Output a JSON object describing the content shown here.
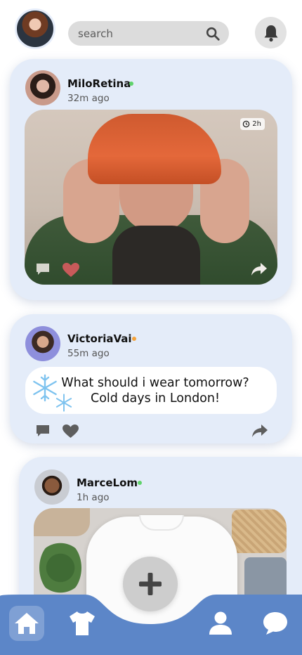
{
  "header": {
    "search": {
      "placeholder": "search"
    },
    "icons": [
      "profile-avatar",
      "search-icon",
      "bell-icon"
    ]
  },
  "posts": [
    {
      "username": "MiloRetina",
      "time": "32m ago",
      "status_color": "#5fd36b",
      "photo_badge": "2h",
      "icons": [
        "comment-icon",
        "heart-icon",
        "share-icon"
      ]
    },
    {
      "username": "VictoriaVai",
      "time": "55m ago",
      "status_color": "#f5a33b",
      "text_line1": "What should i wear tomorrow?",
      "text_line2": "Cold days in London!",
      "icons": [
        "snowflake-icon",
        "comment-icon",
        "heart-icon",
        "share-icon"
      ]
    },
    {
      "username": "MarceLom",
      "time": "1h ago",
      "status_color": "#5fd36b"
    }
  ],
  "colors": {
    "card_background": "#e4ecf9",
    "nav_background": "#5c86c8",
    "like_active": "#c85a5a"
  },
  "bottom_nav": {
    "items": [
      "home-icon",
      "tshirt-icon",
      "add-icon",
      "profile-icon",
      "chat-icon"
    ],
    "active": "home"
  }
}
